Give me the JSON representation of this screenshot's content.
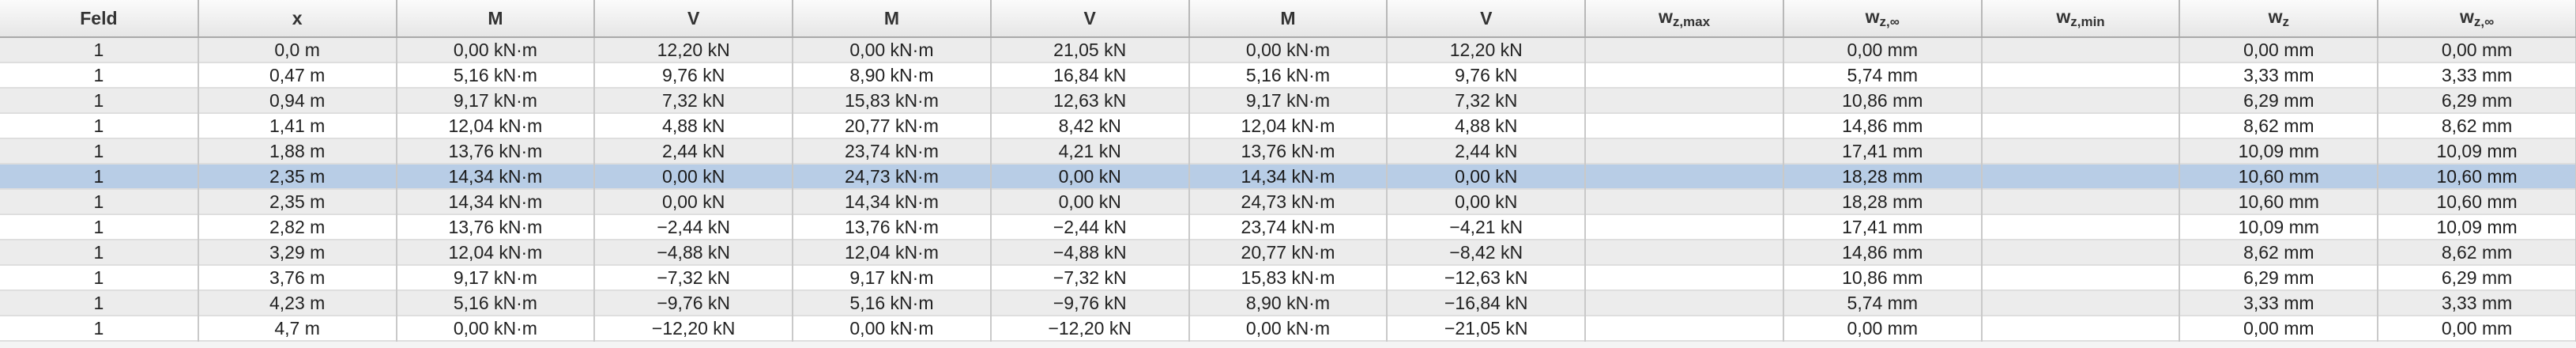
{
  "table": {
    "headers": [
      {
        "main": "Feld",
        "sub": ""
      },
      {
        "main": "x",
        "sub": ""
      },
      {
        "main": "M",
        "sub": ""
      },
      {
        "main": "V",
        "sub": ""
      },
      {
        "main": "M",
        "sub": ""
      },
      {
        "main": "V",
        "sub": ""
      },
      {
        "main": "M",
        "sub": ""
      },
      {
        "main": "V",
        "sub": ""
      },
      {
        "main": "w",
        "sub": "z,max"
      },
      {
        "main": "w",
        "sub": "z,∞"
      },
      {
        "main": "w",
        "sub": "z,min"
      },
      {
        "main": "w",
        "sub": "z"
      },
      {
        "main": "w",
        "sub": "z,∞"
      }
    ],
    "selected_row": 5,
    "rows": [
      [
        "1",
        "0,0 m",
        "0,00 kN·m",
        "12,20 kN",
        "0,00 kN·m",
        "21,05 kN",
        "0,00 kN·m",
        "12,20 kN",
        "",
        "0,00 mm",
        "",
        "0,00 mm",
        "0,00 mm"
      ],
      [
        "1",
        "0,47 m",
        "5,16 kN·m",
        "9,76 kN",
        "8,90 kN·m",
        "16,84 kN",
        "5,16 kN·m",
        "9,76 kN",
        "",
        "5,74 mm",
        "",
        "3,33 mm",
        "3,33 mm"
      ],
      [
        "1",
        "0,94 m",
        "9,17 kN·m",
        "7,32 kN",
        "15,83 kN·m",
        "12,63 kN",
        "9,17 kN·m",
        "7,32 kN",
        "",
        "10,86 mm",
        "",
        "6,29 mm",
        "6,29 mm"
      ],
      [
        "1",
        "1,41 m",
        "12,04 kN·m",
        "4,88 kN",
        "20,77 kN·m",
        "8,42 kN",
        "12,04 kN·m",
        "4,88 kN",
        "",
        "14,86 mm",
        "",
        "8,62 mm",
        "8,62 mm"
      ],
      [
        "1",
        "1,88 m",
        "13,76 kN·m",
        "2,44 kN",
        "23,74 kN·m",
        "4,21 kN",
        "13,76 kN·m",
        "2,44 kN",
        "",
        "17,41 mm",
        "",
        "10,09 mm",
        "10,09 mm"
      ],
      [
        "1",
        "2,35 m",
        "14,34 kN·m",
        "0,00 kN",
        "24,73 kN·m",
        "0,00 kN",
        "14,34 kN·m",
        "0,00 kN",
        "",
        "18,28 mm",
        "",
        "10,60 mm",
        "10,60 mm"
      ],
      [
        "1",
        "2,35 m",
        "14,34 kN·m",
        "0,00 kN",
        "14,34 kN·m",
        "0,00 kN",
        "24,73 kN·m",
        "0,00 kN",
        "",
        "18,28 mm",
        "",
        "10,60 mm",
        "10,60 mm"
      ],
      [
        "1",
        "2,82 m",
        "13,76 kN·m",
        "−2,44 kN",
        "13,76 kN·m",
        "−2,44 kN",
        "23,74 kN·m",
        "−4,21 kN",
        "",
        "17,41 mm",
        "",
        "10,09 mm",
        "10,09 mm"
      ],
      [
        "1",
        "3,29 m",
        "12,04 kN·m",
        "−4,88 kN",
        "12,04 kN·m",
        "−4,88 kN",
        "20,77 kN·m",
        "−8,42 kN",
        "",
        "14,86 mm",
        "",
        "8,62 mm",
        "8,62 mm"
      ],
      [
        "1",
        "3,76 m",
        "9,17 kN·m",
        "−7,32 kN",
        "9,17 kN·m",
        "−7,32 kN",
        "15,83 kN·m",
        "−12,63 kN",
        "",
        "10,86 mm",
        "",
        "6,29 mm",
        "6,29 mm"
      ],
      [
        "1",
        "4,23 m",
        "5,16 kN·m",
        "−9,76 kN",
        "5,16 kN·m",
        "−9,76 kN",
        "8,90 kN·m",
        "−16,84 kN",
        "",
        "5,74 mm",
        "",
        "3,33 mm",
        "3,33 mm"
      ],
      [
        "1",
        "4,7 m",
        "0,00 kN·m",
        "−12,20 kN",
        "0,00 kN·m",
        "−12,20 kN",
        "0,00 kN·m",
        "−21,05 kN",
        "",
        "0,00 mm",
        "",
        "0,00 mm",
        "0,00 mm"
      ]
    ]
  },
  "colors": {
    "selected_row": "#b8cde6",
    "odd_row": "#ececec",
    "even_row": "#ffffff"
  }
}
